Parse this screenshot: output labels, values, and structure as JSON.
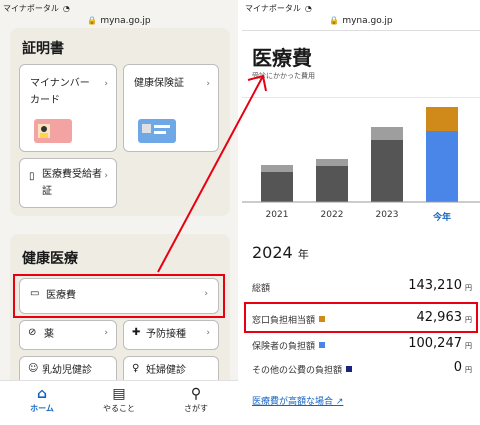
{
  "status": {
    "carrier": "マイナポータル",
    "url": "myna.go.jp"
  },
  "left": {
    "section1_title": "証明書",
    "tiles1": [
      {
        "label": "マイナンバーカード",
        "line1": "マイナンバー",
        "line2": "カード"
      },
      {
        "label": "健康保険証"
      },
      {
        "label": "医療費受給者証",
        "line1": "医療費受給者",
        "line2": "証"
      }
    ],
    "section2_title": "健康医療",
    "medical_cost": "医療費",
    "tiles2": [
      {
        "label": "薬"
      },
      {
        "label": "予防接種"
      },
      {
        "label": "乳幼児健診"
      },
      {
        "label": "妊婦健診"
      }
    ],
    "nav": [
      {
        "label": "ホーム",
        "icon": "home-icon"
      },
      {
        "label": "やること",
        "icon": "clipboard-icon"
      },
      {
        "label": "さがす",
        "icon": "search-icon"
      }
    ]
  },
  "right": {
    "title": "医療費",
    "subtitle": "受診にかかった費用",
    "year_heading": "2024",
    "year_suffix": "年",
    "rows": [
      {
        "label": "総額",
        "value": "143,210",
        "unit": "円"
      },
      {
        "label": "窓口負担相当額",
        "value": "42,963",
        "unit": "円",
        "color": "#d08a1a"
      },
      {
        "label": "保険者の負担額",
        "value": "100,247",
        "unit": "円",
        "color": "#4a86e8"
      },
      {
        "label": "その他の公費の負担額",
        "value": "0",
        "unit": "円",
        "color": "#1a237e"
      }
    ],
    "link": "医療費が高額な場合"
  },
  "chart_data": {
    "type": "bar",
    "categories": [
      "2021",
      "2022",
      "2023",
      "今年"
    ],
    "series": [
      {
        "values": [
          30,
          36,
          62,
          71
        ]
      },
      {
        "values": [
          7,
          7,
          13,
          24
        ]
      }
    ],
    "colors_past": [
      "#555555",
      "#9e9e9e"
    ],
    "colors_current": [
      "#4a86e8",
      "#d08a1a"
    ],
    "highlight_category": "今年"
  }
}
